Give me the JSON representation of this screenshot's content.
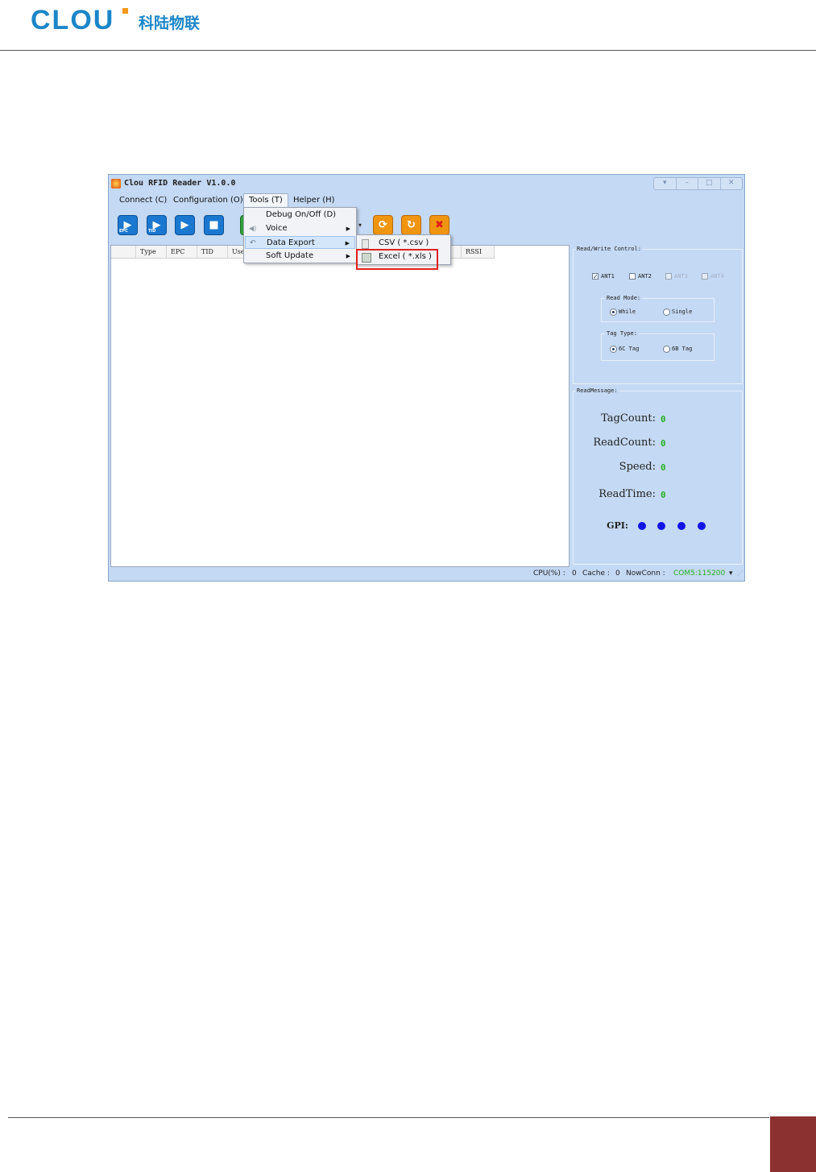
{
  "doc": {
    "logo_text": "CLOU",
    "logo_cn": "科陆物联"
  },
  "app": {
    "title": "Clou RFID Reader V1.0.0",
    "window_controls": [
      "▾",
      "–",
      "□",
      "✕"
    ],
    "menu": {
      "connect": "Connect (C)",
      "configuration": "Configuration (O)",
      "tools": "Tools (T)",
      "helper": "Helper (H)"
    },
    "toolbar": {
      "epc": "EPC",
      "tid": "TID"
    },
    "grid_columns": [
      "Type",
      "EPC",
      "TID",
      "User",
      "RSSI"
    ],
    "tools_menu": [
      {
        "label": "Debug On/Off (D)"
      },
      {
        "label": "Voice"
      },
      {
        "label": "Data Export"
      },
      {
        "label": "Soft Update"
      }
    ],
    "export_menu": [
      {
        "label": "CSV ( *.csv )"
      },
      {
        "label": "Excel ( *.xls )"
      }
    ],
    "read_write": {
      "title": "Read/Write Control:",
      "ant1": "ANT1",
      "ant2": "ANT2",
      "ant3": "ANT3",
      "ant4": "ANT4",
      "read_mode_title": "Read Mode:",
      "mode_while": "While",
      "mode_single": "Single",
      "tag_type_title": "Tag Type:",
      "tag_6c": "6C Tag",
      "tag_6b": "6B Tag"
    },
    "read_message": {
      "title": "ReadMessage:",
      "tag_count_label": "TagCount:",
      "tag_count": "0",
      "read_count_label": "ReadCount:",
      "read_count": "0",
      "speed_label": "Speed:",
      "speed": "0",
      "read_time_label": "ReadTime:",
      "read_time": "0",
      "gpi_label": "GPI:"
    },
    "status": {
      "cpu_label": "CPU(%) :",
      "cpu": "0",
      "cache_label": "Cache :",
      "cache": "0",
      "nowconn_label": "NowConn :",
      "conn": "COM5:115200",
      "conn_color": "#27b024"
    }
  }
}
